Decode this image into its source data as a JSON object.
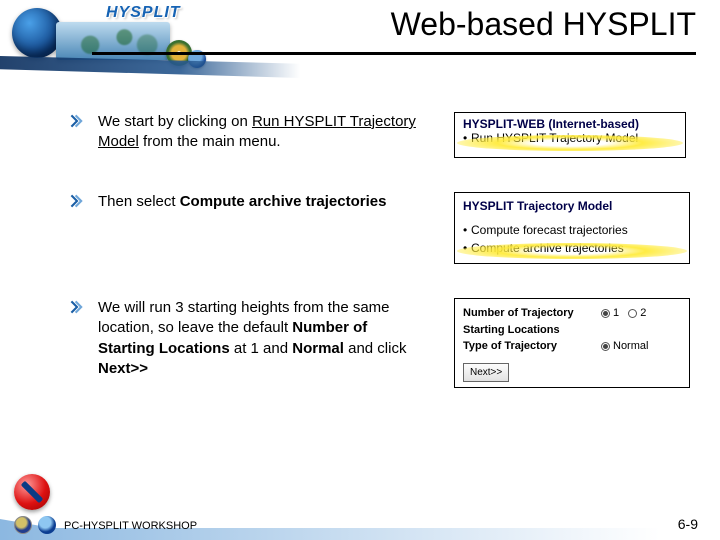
{
  "header": {
    "logo_label": "HYSPLIT",
    "title": "Web-based HYSPLIT"
  },
  "bullets": {
    "b1_pre": "We start by clicking on ",
    "b1_link": "Run HYSPLIT Trajectory Model",
    "b1_post": " from the main menu.",
    "b2_pre": "Then select ",
    "b2_bold": "Compute archive trajectories",
    "b3": "We will run 3 starting heights from the same location, so leave the default ",
    "b3_bold1": "Number of Starting Locations",
    "b3_mid": " at 1 and ",
    "b3_bold2": "Normal",
    "b3_mid2": " and click ",
    "b3_bold3": "Next>>"
  },
  "shot1": {
    "caption": "HYSPLIT-WEB (Internet-based)",
    "item": "Run HYSPLIT Trajectory Model"
  },
  "shot2": {
    "caption": "HYSPLIT Trajectory Model",
    "item_a": "Compute forecast trajectories",
    "item_b": "Compute archive trajectories"
  },
  "shot3": {
    "row1_label": "Number of Trajectory Starting Locations",
    "row1_opt1": "1",
    "row1_opt2": "2",
    "row2_label": "Type of Trajectory",
    "row2_opt1": "Normal",
    "next": "Next>>"
  },
  "footer": {
    "workshop": "PC-HYSPLIT WORKSHOP",
    "page": "6-9"
  }
}
